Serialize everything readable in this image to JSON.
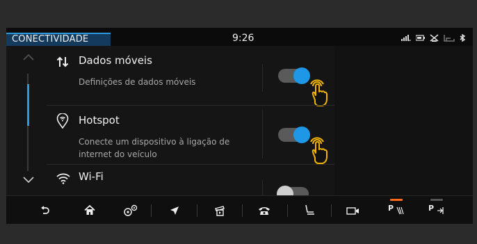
{
  "status": {
    "title": "CONECTIVIDADE",
    "time": "9:26",
    "indicators": [
      "signal-icon",
      "battery-icon",
      "mute-icon",
      "seat-icon",
      "bluetooth-icon"
    ]
  },
  "list": {
    "items": [
      {
        "icon": "mobile-data-icon",
        "title": "Dados móveis",
        "subtitle": "Definições de dados móveis",
        "toggle": "on"
      },
      {
        "icon": "hotspot-icon",
        "title": "Hotspot",
        "subtitle": "Conecte um dispositivo à ligação de internet do veículo",
        "toggle": "on"
      },
      {
        "icon": "wifi-icon",
        "title": "Wi-Fi",
        "subtitle": "",
        "toggle": "off"
      }
    ]
  },
  "navbar": {
    "items": [
      "back-icon",
      "home-icon",
      "settings-icon",
      "navigation-icon",
      "media-icon",
      "phone-icon",
      "seat-icon",
      "camera-icon",
      "parking-assist-icon",
      "park-exit-icon"
    ],
    "park_assist_label": "P",
    "park_exit_label": "P"
  },
  "colors": {
    "accent": "#1e97e6",
    "highlight": "#ff6a1a"
  }
}
